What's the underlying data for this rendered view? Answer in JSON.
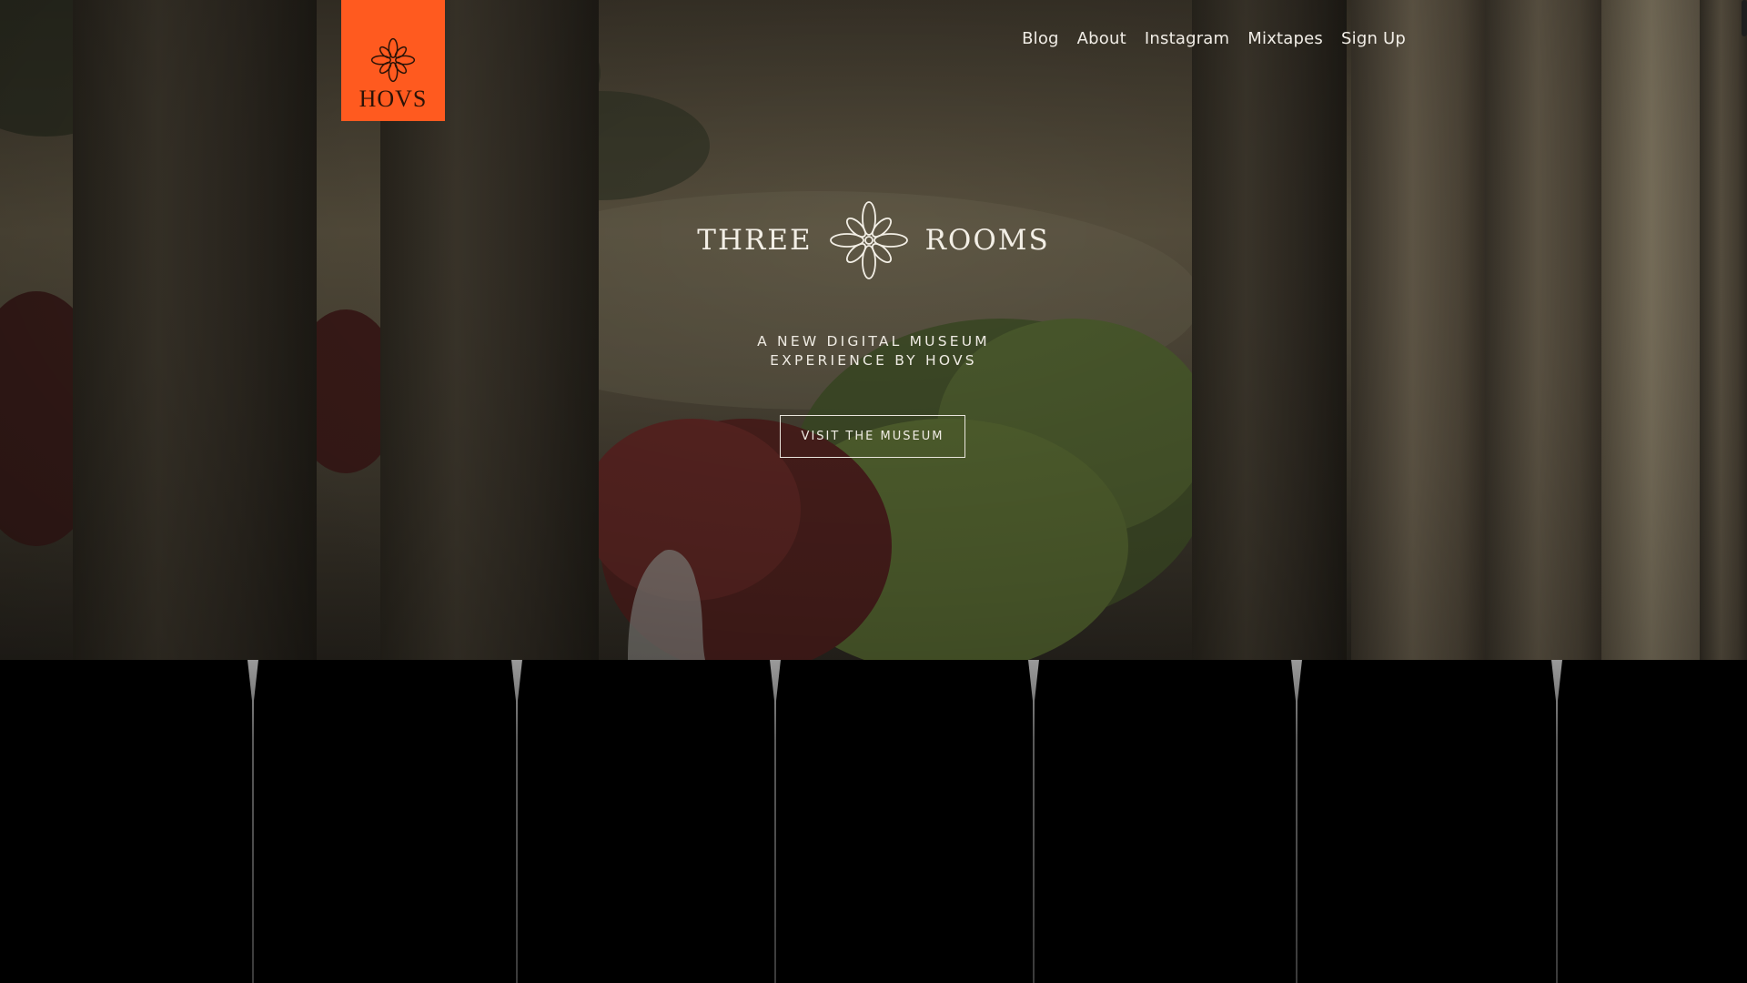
{
  "brand": {
    "logo_text": "HOVS",
    "accent_color": "#ff5a1f",
    "logo_icon": "ornament-icon"
  },
  "nav": {
    "items": [
      {
        "label": "Blog"
      },
      {
        "label": "About"
      },
      {
        "label": "Instagram"
      },
      {
        "label": "Mixtapes"
      },
      {
        "label": "Sign Up"
      }
    ]
  },
  "hero": {
    "title_left": "THREE",
    "title_right": "ROOMS",
    "title_icon": "ornament-icon",
    "subtitle_line1": "A NEW DIGITAL MUSEUM",
    "subtitle_line2": "EXPERIENCE BY HOVS",
    "cta_label": "VISIT THE MUSEUM"
  }
}
